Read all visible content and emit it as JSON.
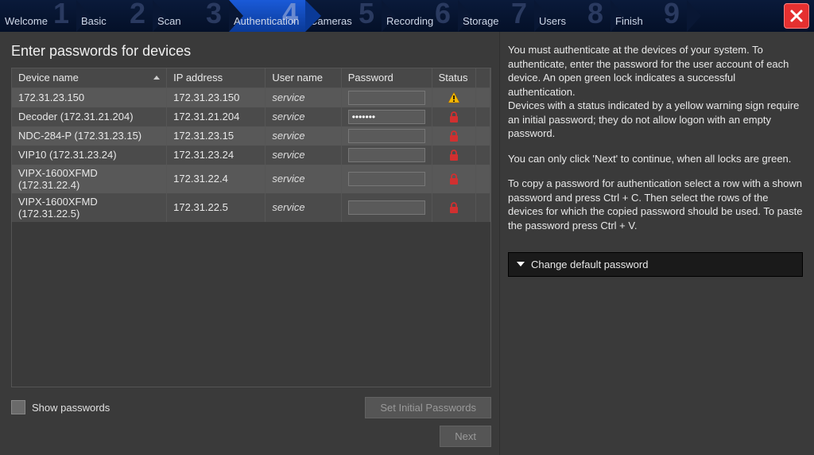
{
  "steps": [
    {
      "num": "1",
      "label": "Welcome"
    },
    {
      "num": "2",
      "label": "Basic"
    },
    {
      "num": "3",
      "label": "Scan"
    },
    {
      "num": "4",
      "label": "Authentication"
    },
    {
      "num": "5",
      "label": "Cameras"
    },
    {
      "num": "6",
      "label": "Recording"
    },
    {
      "num": "7",
      "label": "Storage"
    },
    {
      "num": "8",
      "label": "Users"
    },
    {
      "num": "9",
      "label": "Finish"
    }
  ],
  "active_step_index": 3,
  "page_title": "Enter passwords for devices",
  "columns": {
    "device_name": "Device name",
    "ip_address": "IP address",
    "user_name": "User name",
    "password": "Password",
    "status": "Status"
  },
  "rows": [
    {
      "device": "172.31.23.150",
      "ip": "172.31.23.150",
      "user": "service",
      "pw": "",
      "status": "warning"
    },
    {
      "device": "Decoder (172.31.21.204)",
      "ip": "172.31.21.204",
      "user": "service",
      "pw": "•••••••",
      "status": "lock"
    },
    {
      "device": "NDC-284-P (172.31.23.15)",
      "ip": "172.31.23.15",
      "user": "service",
      "pw": "",
      "status": "lock"
    },
    {
      "device": "VIP10 (172.31.23.24)",
      "ip": "172.31.23.24",
      "user": "service",
      "pw": "",
      "status": "lock"
    },
    {
      "device": "VIPX-1600XFMD (172.31.22.4)",
      "ip": "172.31.22.4",
      "user": "service",
      "pw": "",
      "status": "lock"
    },
    {
      "device": "VIPX-1600XFMD (172.31.22.5)",
      "ip": "172.31.22.5",
      "user": "service",
      "pw": "",
      "status": "lock"
    }
  ],
  "show_passwords_label": "Show passwords",
  "set_initial_passwords_label": "Set Initial Passwords",
  "next_label": "Next",
  "help": {
    "p1": "You must authenticate at the devices of your system. To authenticate, enter the password for the user account of each device. An open green lock indicates a successful authentication.",
    "p2": "Devices with a status indicated by a yellow warning sign require an initial password; they do not allow logon with an empty password.",
    "p3": "You can only click 'Next' to continue, when all locks are green.",
    "p4": "To copy a password for authentication select a row with a shown password and press Ctrl + C. Then select the rows of the devices for which the copied password should be used. To paste the password press Ctrl + V."
  },
  "change_default_password_label": "Change default password"
}
